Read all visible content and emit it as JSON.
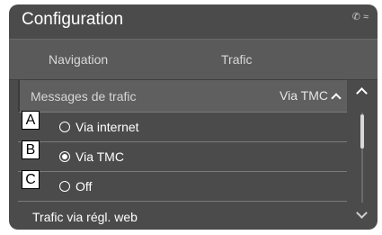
{
  "window": {
    "title": "Configuration"
  },
  "status": {
    "phone_icon": "phone-off-icon",
    "signal_icon": "signal-icon"
  },
  "tabs": [
    {
      "label": "Navigation"
    },
    {
      "label": "Trafic"
    }
  ],
  "setting": {
    "label": "Messages de trafic",
    "value": "Via TMC"
  },
  "options": [
    {
      "callout": "A",
      "label": "Via internet",
      "selected": false
    },
    {
      "callout": "B",
      "label": "Via TMC",
      "selected": true
    },
    {
      "callout": "C",
      "label": "Off",
      "selected": false
    }
  ],
  "next_item": {
    "label": "Trafic via régl. web"
  },
  "colors": {
    "screen_bg": "#4b4b4b",
    "tabbar_bg": "#5a5a5a",
    "text": "#ffffff"
  }
}
